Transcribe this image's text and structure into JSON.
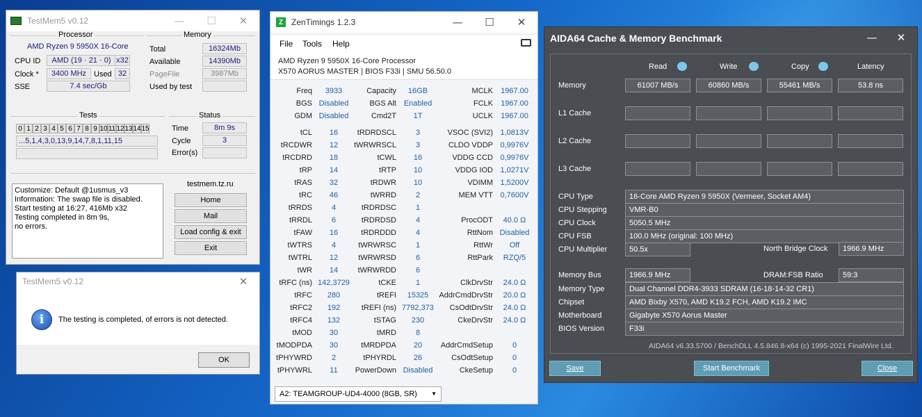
{
  "testmem": {
    "title": "TestMem5 v0.12",
    "processor_group": "Processor",
    "cpu_name": "AMD Ryzen 9 5950X 16-Core",
    "cpu_id_label": "CPU ID",
    "cpu_id_value": "AMD  (19 · 21 · 0)",
    "threads": "x32",
    "clock_label": "Clock *",
    "clock_value": "3400 MHz",
    "used_label": "Used",
    "used_value": "32",
    "sse_label": "SSE",
    "sse_value": "7.4 sec/Gb",
    "memory_group": "Memory",
    "total_label": "Total",
    "total_value": "16324Mb",
    "available_label": "Available",
    "available_value": "14390Mb",
    "pagefile_label": "PageFile",
    "pagefile_value": "3987Mb",
    "usedbytest_label": "Used by test",
    "tests_group": "Tests",
    "test_cells": [
      "0",
      "1",
      "2",
      "3",
      "4",
      "5",
      "6",
      "7",
      "8",
      "9",
      "10",
      "11",
      "12",
      "13",
      "14",
      "15"
    ],
    "test_sequence": "...5,1,4,3,0,13,9,14,7,8,1,11,15",
    "status_group": "Status",
    "time_label": "Time",
    "time_value": "8m 9s",
    "cycle_label": "Cycle",
    "cycle_value": "3",
    "errors_label": "Error(s)",
    "log_lines": [
      "Customize: Default @1usmus_v3",
      "Information: The swap file is disabled.",
      "Start testing at 16:27, 416Mb x32",
      "Testing completed in 8m 9s,",
      "no errors."
    ],
    "site": "testmem.tz.ru",
    "btn_home": "Home",
    "btn_mail": "Mail",
    "btn_load": "Load config & exit",
    "btn_exit": "Exit"
  },
  "dialog": {
    "title": "TestMem5 v0.12",
    "message": "The testing is completed, of errors is not detected.",
    "ok": "OK"
  },
  "zen": {
    "title": "ZenTimings 1.2.3",
    "menu": [
      "File",
      "Tools",
      "Help"
    ],
    "cpu": "AMD Ryzen 9 5950X 16-Core Processor",
    "board": "X570 AORUS MASTER | BIOS F33i | SMU 56.50.0",
    "rows": [
      [
        "Freq",
        "3933",
        "Capacity",
        "16GB",
        "MCLK",
        "1967.00"
      ],
      [
        "BGS",
        "Disabled",
        "BGS Alt",
        "Enabled",
        "FCLK",
        "1967.00"
      ],
      [
        "GDM",
        "Disabled",
        "Cmd2T",
        "1T",
        "UCLK",
        "1967.00"
      ],
      [
        "tCL",
        "16",
        "tRDRDSCL",
        "3",
        "VSOC (SVI2)",
        "1,0813V"
      ],
      [
        "tRCDWR",
        "12",
        "tWRWRSCL",
        "3",
        "CLDO VDDP",
        "0,9976V"
      ],
      [
        "tRCDRD",
        "18",
        "tCWL",
        "16",
        "VDDG CCD",
        "0,9976V"
      ],
      [
        "tRP",
        "14",
        "tRTP",
        "10",
        "VDDG IOD",
        "1,0271V"
      ],
      [
        "tRAS",
        "32",
        "tRDWR",
        "10",
        "VDIMM",
        "1,5200V"
      ],
      [
        "tRC",
        "46",
        "tWRRD",
        "2",
        "MEM VTT",
        "0,7600V"
      ],
      [
        "tRRDS",
        "4",
        "tRDRDSC",
        "1",
        "",
        ""
      ],
      [
        "tRRDL",
        "6",
        "tRDRDSD",
        "4",
        "ProcODT",
        "40.0 Ω"
      ],
      [
        "tFAW",
        "16",
        "tRDRDDD",
        "4",
        "RttNom",
        "Disabled"
      ],
      [
        "tWTRS",
        "4",
        "tWRWRSC",
        "1",
        "RttWr",
        "Off"
      ],
      [
        "tWTRL",
        "12",
        "tWRWRSD",
        "6",
        "RttPark",
        "RZQ/5"
      ],
      [
        "tWR",
        "14",
        "tWRWRDD",
        "6",
        "",
        ""
      ],
      [
        "tRFC (ns)",
        "142,3729",
        "tCKE",
        "1",
        "ClkDrvStr",
        "24.0 Ω"
      ],
      [
        "tRFC",
        "280",
        "tREFI",
        "15325",
        "AddrCmdDrvStr",
        "20.0 Ω"
      ],
      [
        "tRFC2",
        "192",
        "tREFI (ns)",
        "7792,373",
        "CsOdtDrvStr",
        "24.0 Ω"
      ],
      [
        "tRFC4",
        "132",
        "tSTAG",
        "230",
        "CkeDrvStr",
        "24.0 Ω"
      ],
      [
        "tMOD",
        "30",
        "tMRD",
        "8",
        "",
        ""
      ],
      [
        "tMODPDA",
        "30",
        "tMRDPDA",
        "20",
        "AddrCmdSetup",
        "0"
      ],
      [
        "tPHYWRD",
        "2",
        "tPHYRDL",
        "26",
        "CsOdtSetup",
        "0"
      ],
      [
        "tPHYWRL",
        "11",
        "PowerDown",
        "Disabled",
        "CkeSetup",
        "0"
      ]
    ],
    "dimm": "A2: TEAMGROUP-UD4-4000 (8GB, SR)"
  },
  "aida": {
    "title": "AIDA64 Cache & Memory Benchmark",
    "cols": [
      "Read",
      "Write",
      "Copy",
      "Latency"
    ],
    "row_labels": [
      "Memory",
      "L1 Cache",
      "L2 Cache",
      "L3 Cache"
    ],
    "memory_values": [
      "61007 MB/s",
      "60860 MB/s",
      "55461 MB/s",
      "53.8 ns"
    ],
    "info": [
      [
        "CPU Type",
        "16-Core AMD Ryzen 9 5950X  (Vermeer, Socket AM4)"
      ],
      [
        "CPU Stepping",
        "VMR-B0"
      ],
      [
        "CPU Clock",
        "5050.5 MHz"
      ],
      [
        "CPU FSB",
        "100.0 MHz  (original: 100 MHz)"
      ],
      [
        "CPU Multiplier",
        "50.5x"
      ]
    ],
    "nb_label": "North Bridge Clock",
    "nb_value": "1966.9 MHz",
    "membus_label": "Memory Bus",
    "membus_value": "1966.9 MHz",
    "dramfsb_label": "DRAM:FSB Ratio",
    "dramfsb_value": "59:3",
    "info2": [
      [
        "Memory Type",
        "Dual Channel DDR4-3933 SDRAM  (16-18-14-32 CR1)"
      ],
      [
        "Chipset",
        "AMD Bixby X570, AMD K19.2 FCH, AMD K19.2 IMC"
      ],
      [
        "Motherboard",
        "Gigabyte X570 Aorus Master"
      ],
      [
        "BIOS Version",
        "F33i"
      ]
    ],
    "footer": "AIDA64 v6.33.5700 / BenchDLL 4.5.846.8-x64  (c) 1995-2021 FinalWire Ltd.",
    "btn_save": "Save",
    "btn_start": "Start Benchmark",
    "btn_close": "Close"
  }
}
